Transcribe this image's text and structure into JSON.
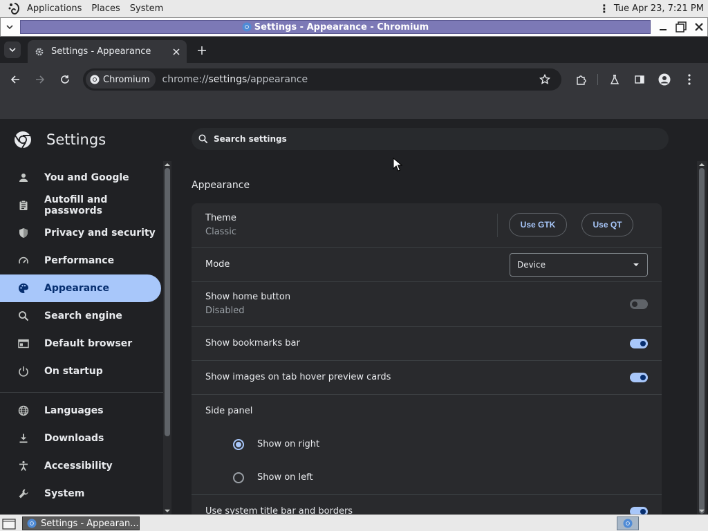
{
  "gnome_panel": {
    "menus": [
      "Applications",
      "Places",
      "System"
    ],
    "clock": "Tue Apr 23,  7:21 PM"
  },
  "window": {
    "title": "Settings - Appearance - Chromium"
  },
  "tabs": {
    "active_title": "Settings - Appearance"
  },
  "toolbar": {
    "site_chip": "Chromium",
    "url_prefix": "chrome://",
    "url_host": "settings",
    "url_path": "/appearance"
  },
  "settings": {
    "title": "Settings",
    "search_placeholder": "Search settings",
    "nav": [
      {
        "label": "You and Google",
        "icon": "person-icon"
      },
      {
        "label": "Autofill and passwords",
        "icon": "clipboard-icon"
      },
      {
        "label": "Privacy and security",
        "icon": "shield-icon"
      },
      {
        "label": "Performance",
        "icon": "speedometer-icon"
      },
      {
        "label": "Appearance",
        "icon": "palette-icon"
      },
      {
        "label": "Search engine",
        "icon": "search-icon"
      },
      {
        "label": "Default browser",
        "icon": "browser-icon"
      },
      {
        "label": "On startup",
        "icon": "power-icon"
      },
      {
        "label": "Languages",
        "icon": "globe-icon"
      },
      {
        "label": "Downloads",
        "icon": "download-icon"
      },
      {
        "label": "Accessibility",
        "icon": "accessibility-icon"
      },
      {
        "label": "System",
        "icon": "wrench-icon"
      }
    ],
    "active_nav": "Appearance",
    "section_title": "Appearance",
    "theme": {
      "label": "Theme",
      "value": "Classic",
      "btn_gtk": "Use GTK",
      "btn_qt": "Use QT"
    },
    "mode": {
      "label": "Mode",
      "selected": "Device"
    },
    "home_button": {
      "label": "Show home button",
      "value": "Disabled",
      "enabled": false
    },
    "bookmarks_bar": {
      "label": "Show bookmarks bar",
      "enabled": true
    },
    "hover_cards": {
      "label": "Show images on tab hover preview cards",
      "enabled": true
    },
    "side_panel": {
      "label": "Side panel",
      "option_right": "Show on right",
      "option_left": "Show on left",
      "selected": "right"
    },
    "system_titlebar": {
      "label": "Use system title bar and borders",
      "enabled": true
    }
  },
  "taskbar": {
    "item": "Settings - Appearan..."
  },
  "colors": {
    "accent": "#a8c7fa",
    "page_bg": "#202124",
    "card_bg": "#292a2d"
  }
}
